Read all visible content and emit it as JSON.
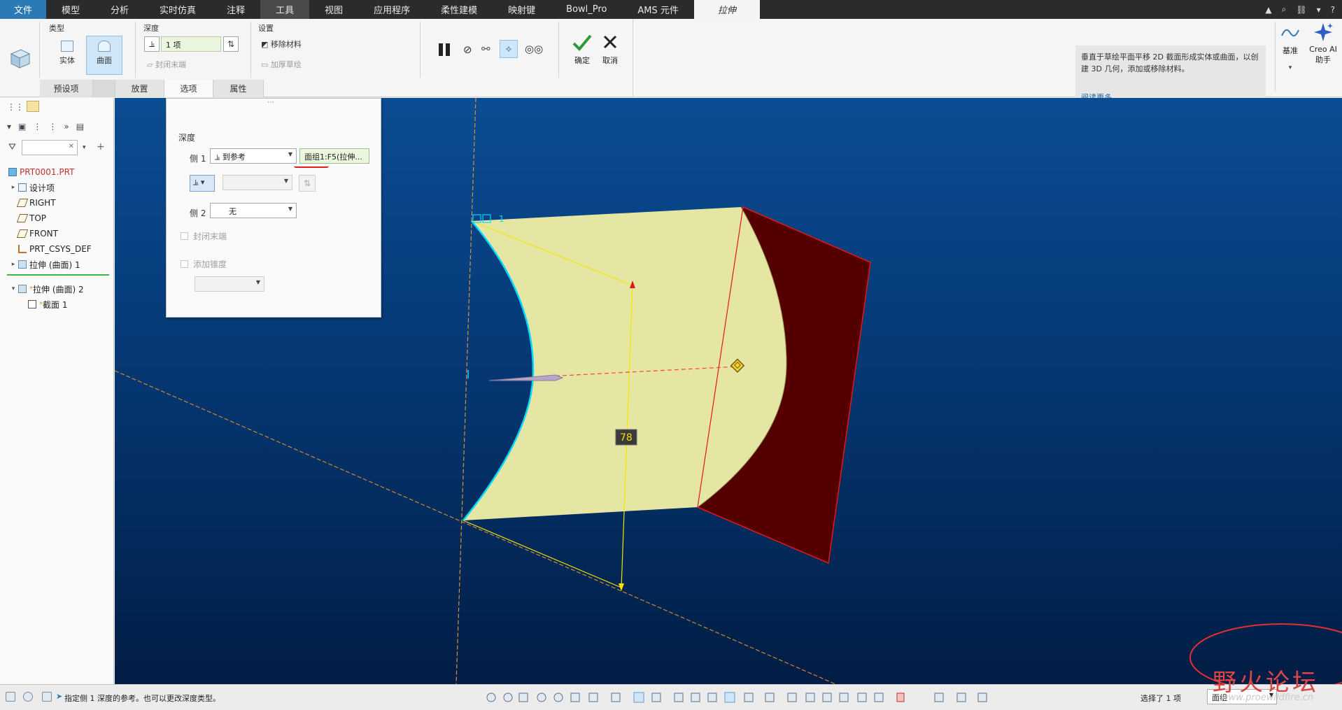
{
  "menubar": {
    "tabs": [
      "文件",
      "模型",
      "分析",
      "实时仿真",
      "注释",
      "工具",
      "视图",
      "应用程序",
      "柔性建模",
      "映射键",
      "Bowl_Pro",
      "AMS 元件",
      "拉伸"
    ],
    "right_icons": [
      "triangle-up",
      "search-icon",
      "link-icon",
      "chevron-down-icon",
      "help-icon"
    ]
  },
  "ribbon": {
    "type_label": "类型",
    "solid_label": "实体",
    "surface_label": "曲面",
    "depth_label": "深度",
    "depth_value": "1 项",
    "cap_ends_label": "封闭末端",
    "settings_label": "设置",
    "remove_material_label": "移除材料",
    "thicken_label": "加厚草绘",
    "ok_label": "确定",
    "cancel_label": "取消",
    "datum_label": "基准",
    "creo_ai_label_1": "Creo AI",
    "creo_ai_label_2": "助手",
    "tabs": [
      "预设项",
      "放置",
      "选项",
      "属性"
    ],
    "help_text": "垂直于草绘平面平移 2D 截面形成实体或曲面，以创建 3D 几何，添加或移除材料。",
    "help_more": "阅读更多..."
  },
  "tree": {
    "items": [
      {
        "label": "PRT0001.PRT",
        "color": "#d13b3b"
      },
      {
        "label": "设计项"
      },
      {
        "label": "RIGHT"
      },
      {
        "label": "TOP"
      },
      {
        "label": "FRONT"
      },
      {
        "label": "PRT_CSYS_DEF"
      },
      {
        "label": "拉伸 (曲面) 1"
      },
      {
        "label": "拉伸 (曲面) 2"
      },
      {
        "label": "截面 1"
      }
    ]
  },
  "options_panel": {
    "depth_label": "深度",
    "side1_label": "侧 1",
    "side1_type": "到参考",
    "side1_reference": "面组1:F5(拉伸...",
    "side2_label": "侧 2",
    "side2_type": "无",
    "cap_ends_label": "封闭末端",
    "add_taper_label": "添加锥度"
  },
  "viewport": {
    "dimension_value": "78",
    "sketch_label": "1"
  },
  "statusbar": {
    "message": "指定侧 1 深度的参考。也可以更改深度类型。",
    "selection_count": "选择了 1 项",
    "filter_value": "面组"
  },
  "watermark": {
    "text": "野火论坛",
    "url": "www.proewildfire.cn"
  },
  "colors": {
    "accent": "#2c7ab5",
    "surface_fill": "#e6e6a4",
    "plane_fill": "#540000",
    "edge_highlight": "#00d8ff",
    "reference_red": "#e01818"
  }
}
